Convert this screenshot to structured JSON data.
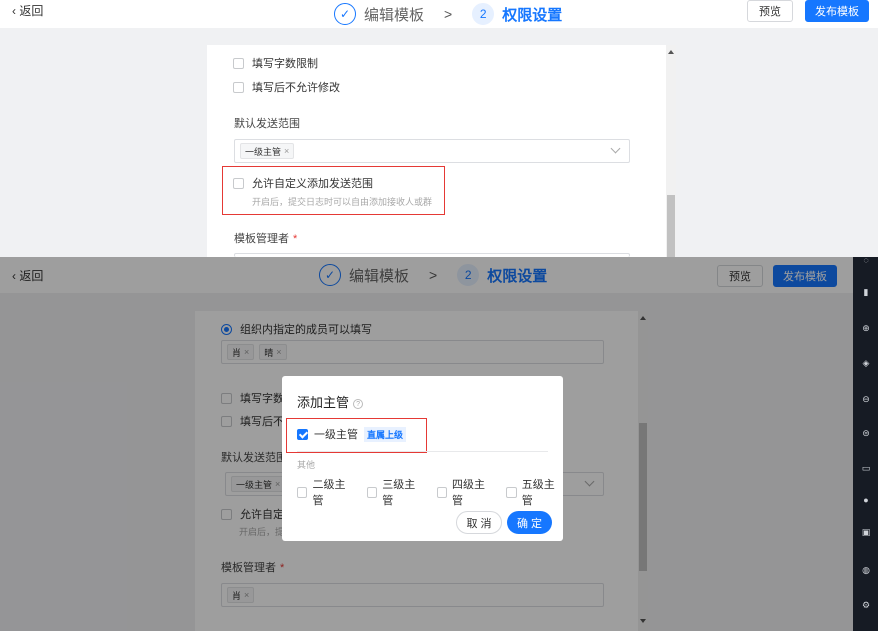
{
  "header": {
    "back_label": "‹ 返回",
    "step1_icon": "check-icon",
    "step1_label": "编辑模板",
    "arrow": ">",
    "step2_number": "2",
    "step2_label": "权限设置",
    "preview_label": "预览",
    "publish_label": "发布模板"
  },
  "form_top": {
    "word_limit_label": "填写字数限制",
    "no_edit_label": "填写后不允许修改",
    "default_range_title": "默认发送范围",
    "default_range_tag": "一级主管",
    "tag_close": "×",
    "custom_range_label": "允许自定义添加发送范围",
    "custom_range_hint": "开启后，提交日志时可以自由添加接收人或群",
    "admin_title": "模板管理者",
    "required_mark": "*"
  },
  "form_bottom": {
    "member_fill_label": "组织内指定的成员可以填写",
    "member_tags": [
      "肖",
      "晴"
    ],
    "word_limit_label": "填写字数",
    "no_edit_label": "填写后不",
    "default_range_title": "默认发送范围",
    "default_range_tag": "一级主管",
    "custom_range_label": "允许自定义",
    "custom_range_hint": "开启后，提",
    "admin_title": "模板管理者",
    "admin_tag": "肖",
    "required_mark": "*"
  },
  "dialog": {
    "title": "添加主管",
    "help_icon": "?",
    "primary_option": "一级主管",
    "primary_badge": "直属上级",
    "others_title": "其他",
    "options": [
      "二级主管",
      "三级主管",
      "四级主管",
      "五级主管"
    ],
    "cancel_label": "取 消",
    "confirm_label": "确 定"
  },
  "rail_icons": [
    "top-icon",
    "book-icon",
    "box-icon",
    "cube-icon",
    "chat-icon",
    "db-icon",
    "card-icon",
    "gear-alt-icon",
    "doc-icon",
    "alarm-icon",
    "settings-icon"
  ],
  "colors": {
    "accent": "#1677ff",
    "highlight": "#e53935",
    "rail": "#161b24"
  }
}
